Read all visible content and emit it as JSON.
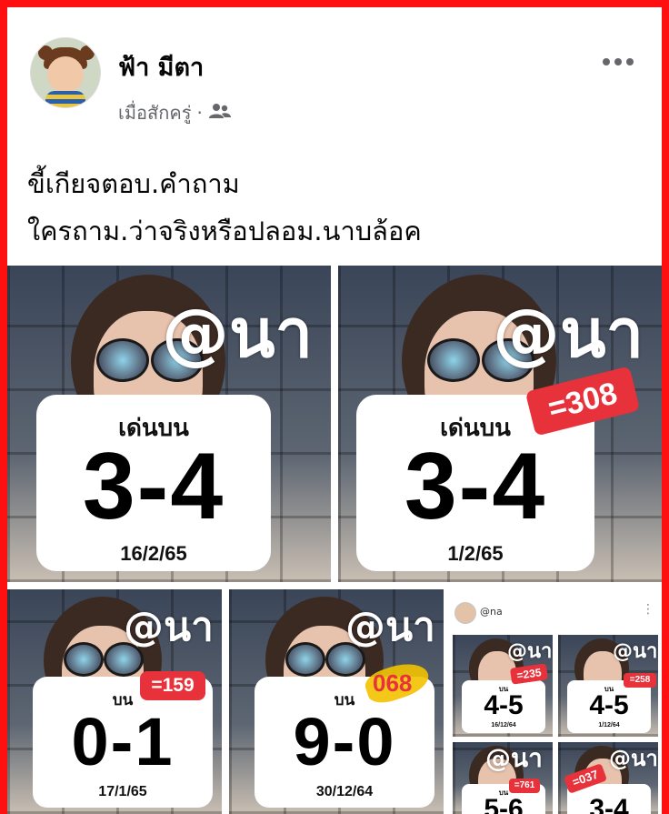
{
  "post": {
    "author": "ฟ้า มีตา",
    "time": "เมื่อสักครู่",
    "separator": "·",
    "audience_icon": "friends-icon",
    "more_icon": "more-options-icon",
    "caption_line1": "ขี้เกียจตอบ.คำถาม",
    "caption_line2": "ใครถาม.ว่าจริงหรือปลอม.นาบล้อค"
  },
  "colors": {
    "frame": "#ff1010",
    "badge": "#e8323b",
    "highlight": "#f2c200"
  },
  "images": [
    {
      "handle": "@นา",
      "label": "เด่นบน",
      "number": "3-4",
      "date": "16/2/65",
      "badge": ""
    },
    {
      "handle": "@นา",
      "label": "เด่นบน",
      "number": "3-4",
      "date": "1/2/65",
      "badge": "=308"
    },
    {
      "handle": "@นา",
      "label": "บน",
      "number": "0-1",
      "date": "17/1/65",
      "badge": "=159"
    },
    {
      "handle": "@นา",
      "label": "บน",
      "number": "9-0",
      "date": "30/12/64",
      "badge": "068"
    },
    {
      "header_name": "@na",
      "tiles": [
        {
          "handle": "@นา",
          "label": "บน",
          "number": "4-5",
          "date": "16/12/64",
          "badge": "=235"
        },
        {
          "handle": "@นา",
          "label": "บน",
          "number": "4-5",
          "date": "1/12/64",
          "badge": "=258"
        },
        {
          "handle": "@นา",
          "label": "บน",
          "number": "5-6",
          "date": "",
          "badge": "=761"
        },
        {
          "handle": "@นา",
          "label": "",
          "number": "3-4",
          "date": "",
          "badge": "=037"
        }
      ]
    }
  ]
}
